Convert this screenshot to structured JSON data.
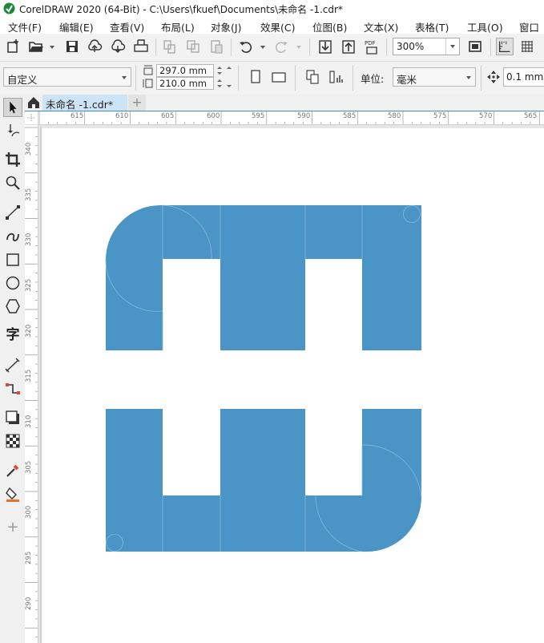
{
  "window": {
    "title": "CorelDRAW 2020 (64-Bit) - C:\\Users\\fkuef\\Documents\\未命名 -1.cdr*"
  },
  "menu": {
    "items": [
      "文件(F)",
      "编辑(E)",
      "查看(V)",
      "布局(L)",
      "对象(J)",
      "效果(C)",
      "位图(B)",
      "文本(X)",
      "表格(T)",
      "工具(O)",
      "窗口"
    ]
  },
  "toolbar": {
    "zoom_level": "300%",
    "pdf_label": "PDF"
  },
  "property_bar": {
    "page_preset": "自定义",
    "page_width": "297.0 mm",
    "page_height": "210.0 mm",
    "units_label": "单位:",
    "units_value": "毫米",
    "nudge_value": "0.1 mm"
  },
  "document_tabs": {
    "active_tab": "未命名 -1.cdr*",
    "add_tab": "+"
  },
  "rulers": {
    "horizontal_labels": [
      "615",
      "610",
      "605",
      "600",
      "595",
      "590",
      "585",
      "580",
      "575",
      "570",
      "565"
    ],
    "vertical_labels": [
      "340",
      "335",
      "330",
      "325",
      "320",
      "315",
      "310",
      "305",
      "300",
      "295",
      "290"
    ]
  },
  "toolbox": {
    "tools": [
      "pick-tool-icon",
      "shape-tool-icon",
      "crop-tool-icon",
      "zoom-tool-icon",
      "freehand-tool-icon",
      "artistic-media-tool-icon",
      "rectangle-tool-icon",
      "ellipse-tool-icon",
      "polygon-tool-icon",
      "text-tool-icon",
      "parallel-dimension-tool-icon",
      "connector-tool-icon",
      "drop-shadow-tool-icon",
      "transparency-tool-icon",
      "eyedropper-tool-icon",
      "interactive-fill-tool-icon",
      "add-tool-icon"
    ],
    "text_tool_glyph": "字"
  },
  "colors": {
    "shape_fill": "#4a94c6",
    "shape_guide": "#86b9dc",
    "tab_active": "#cde4f7",
    "accent": "#3a8fd8"
  }
}
